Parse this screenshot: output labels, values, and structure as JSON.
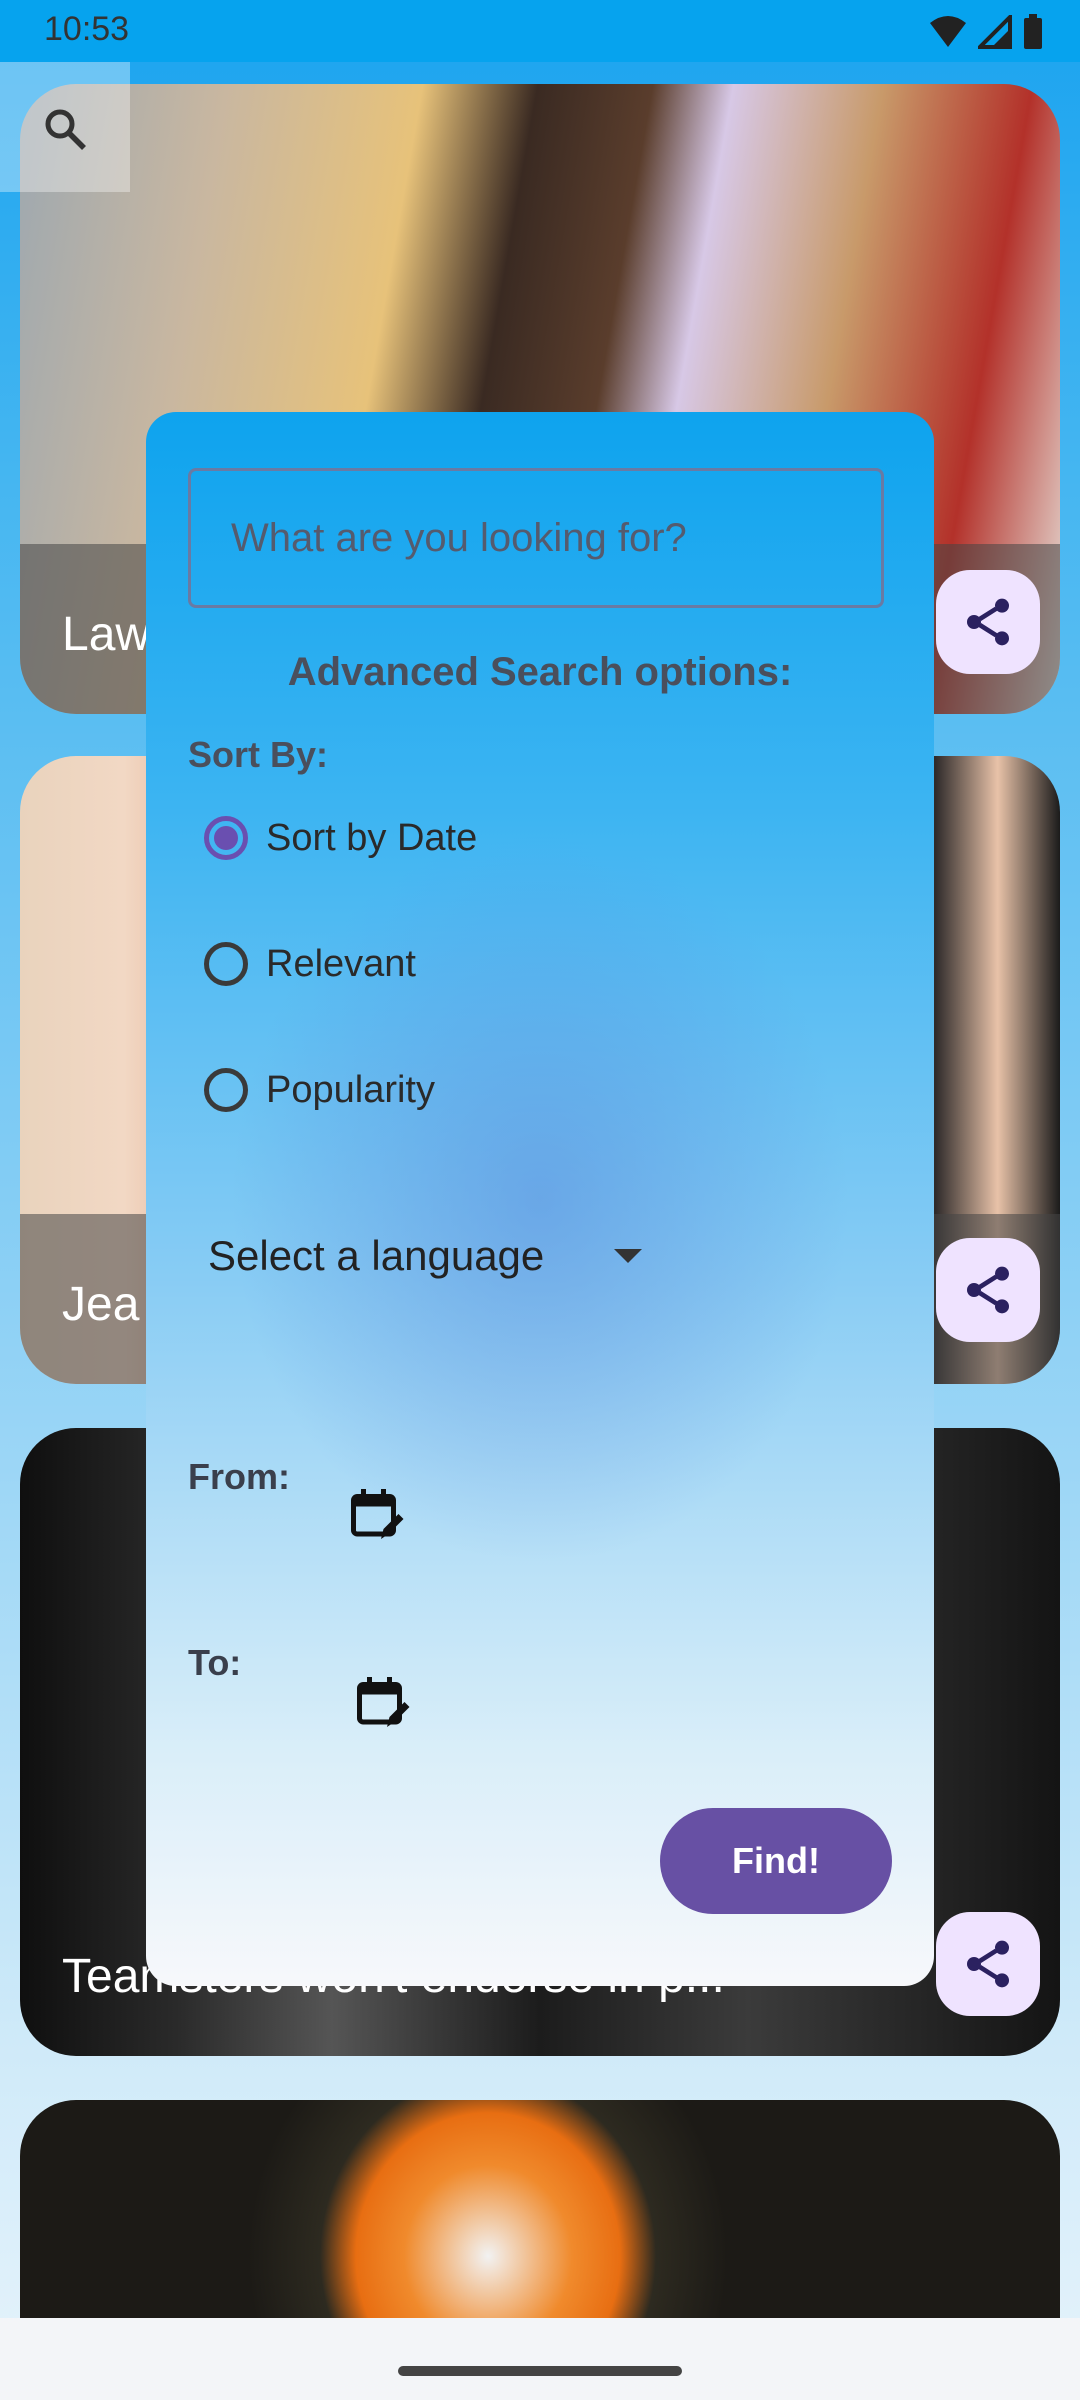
{
  "status_bar": {
    "time": "10:53"
  },
  "cards": [
    {
      "title": "Law",
      "share_label": "share"
    },
    {
      "title": "Jea",
      "share_label": "share"
    },
    {
      "title": "Teamsters won't endorse in p...",
      "share_label": "share"
    },
    {
      "title": ""
    }
  ],
  "search_dialog": {
    "placeholder": "What are you looking for?",
    "title": "Advanced Search options:",
    "sort_by_label": "Sort By:",
    "sort_options": [
      {
        "label": "Sort by Date",
        "selected": true
      },
      {
        "label": "Relevant",
        "selected": false
      },
      {
        "label": "Popularity",
        "selected": false
      }
    ],
    "language_select": "Select a language",
    "from_label": "From:",
    "to_label": "To:",
    "find_label": "Find!"
  },
  "colors": {
    "accent": "#6750a4",
    "status_bar": "#06a3ee",
    "share_bg": "#efe3ff"
  }
}
